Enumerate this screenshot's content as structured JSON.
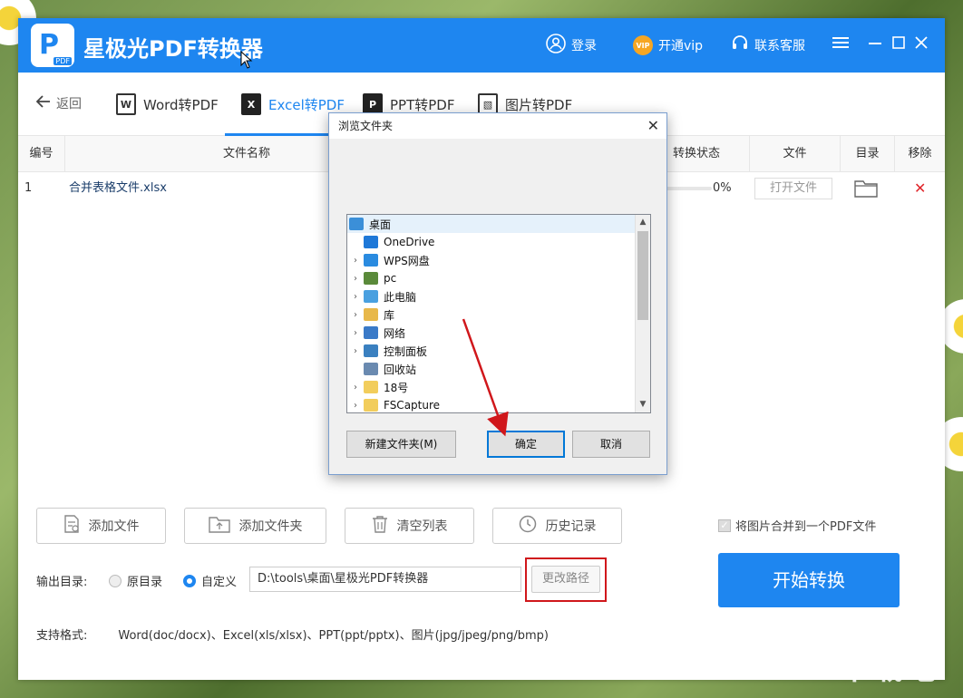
{
  "app": {
    "title": "星极光PDF转换器",
    "logo_letter": "P",
    "logo_tag": "PDF",
    "login": "登录",
    "vip_badge": "VIP",
    "vip": "开通vip",
    "service": "联系客服"
  },
  "nav": {
    "back": "返回",
    "tabs": [
      {
        "label": "Word转PDF",
        "icon": "W"
      },
      {
        "label": "Excel转PDF",
        "icon": "X"
      },
      {
        "label": "PPT转PDF",
        "icon": "P"
      },
      {
        "label": "图片转PDF",
        "icon": "▧"
      }
    ]
  },
  "table": {
    "headers": [
      "编号",
      "文件名称",
      "转换状态",
      "文件",
      "目录",
      "移除"
    ],
    "rows": [
      {
        "no": "1",
        "name": "合并表格文件.xlsx",
        "progress": "0%",
        "progress_value": 0,
        "open": "打开文件"
      }
    ]
  },
  "actions": {
    "add_file": "添加文件",
    "add_folder": "添加文件夹",
    "clear": "清空列表",
    "history": "历史记录"
  },
  "merge_option": "将图片合并到一个PDF文件",
  "output": {
    "label": "输出目录:",
    "original": "原目录",
    "custom": "自定义",
    "path": "D:\\tools\\桌面\\星极光PDF转换器",
    "change_path": "更改路径"
  },
  "start": "开始转换",
  "formats": {
    "label": "支持格式:",
    "value": "Word(doc/docx)、Excel(xls/xlsx)、PPT(ppt/pptx)、图片(jpg/jpeg/png/bmp)"
  },
  "dialog": {
    "title": "浏览文件夹",
    "tree": [
      {
        "label": "桌面",
        "expandable": false,
        "color": "#3b8fd8"
      },
      {
        "label": "OneDrive",
        "expandable": false,
        "color": "#1e78d8"
      },
      {
        "label": "WPS网盘",
        "expandable": true,
        "color": "#2a8be0"
      },
      {
        "label": "pc",
        "expandable": true,
        "color": "#5a8a3a"
      },
      {
        "label": "此电脑",
        "expandable": true,
        "color": "#4aa0e0"
      },
      {
        "label": "库",
        "expandable": true,
        "color": "#e8b84a"
      },
      {
        "label": "网络",
        "expandable": true,
        "color": "#3a7ac8"
      },
      {
        "label": "控制面板",
        "expandable": true,
        "color": "#3a80c0"
      },
      {
        "label": "回收站",
        "expandable": false,
        "color": "#6a8ab0"
      },
      {
        "label": "18号",
        "expandable": true,
        "color": "#f2cd5c"
      },
      {
        "label": "FSCapture",
        "expandable": true,
        "color": "#f2cd5c"
      }
    ],
    "new_folder": "新建文件夹(M)",
    "ok": "确定",
    "cancel": "取消"
  },
  "watermark": "下载吧",
  "colors": {
    "brand": "#1e86f0",
    "highlight": "#d0171b"
  }
}
